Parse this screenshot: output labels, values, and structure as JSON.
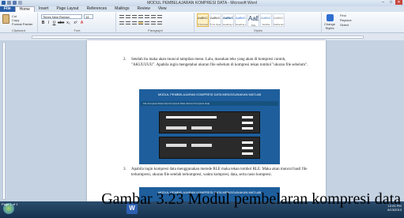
{
  "window": {
    "title": "MODUL PEMBELAJARAN KOMPRESI DATA - Microsoft Word",
    "controls": [
      "–",
      "□",
      "✕"
    ]
  },
  "tabs": [
    "File",
    "Home",
    "Insert",
    "Page Layout",
    "References",
    "Mailings",
    "Review",
    "View"
  ],
  "ribbon": {
    "clipboard": {
      "paste": "Paste",
      "cut": "Cut",
      "copy": "Copy",
      "format_painter": "Format Painter",
      "label": "Clipboard"
    },
    "font": {
      "name": "Times New Roman",
      "size": "14",
      "buttons": [
        "B",
        "I",
        "U",
        "abe",
        "x₂",
        "x²",
        "A"
      ],
      "label": "Font"
    },
    "paragraph_label": "Paragraph",
    "styles": [
      {
        "sample": "AaBbCcDc",
        "name": "¶ Normal"
      },
      {
        "sample": "AaBbCcDc",
        "name": "¶ No Spaci..."
      },
      {
        "sample": "AaBbC",
        "name": "Heading 1"
      },
      {
        "sample": "AaBbCc",
        "name": "Heading 2"
      },
      {
        "sample": "AaB",
        "name": "Title"
      },
      {
        "sample": "AaBbCc.",
        "name": "Subtitle"
      },
      {
        "sample": "AaBbCcDc",
        "name": "Subtle Em..."
      }
    ],
    "styles_label": "Styles",
    "change_styles": "Change Styles",
    "editing": {
      "find": "Find",
      "replace": "Replace",
      "select": "Select",
      "label": "Editing"
    }
  },
  "document": {
    "para2_num": "2.",
    "para2": "Setelah itu maka akan muncul tampilan menu. Lalu, masukan teks yang akan di kompresi contoh, \"AKUUUUU\". Apabila ingin mengetahui ukuran file sebelum di kompresi tekan tombol \"ukuran file sebelum\".",
    "para3_num": "3.",
    "para3": "Apabila ingin kompresi data menggunakan metode RLE maka tekan tombol RLE. Maka akan muncul hasil file terkompresi, ukuran file setelah terkompresi, waktu kompresi, data, serta rasio kompresi.",
    "shot_title": "MODUL PEMBELAJARAN KOMPRESI DATA MENGGUNAKAN MATLAB",
    "shot_menu": "File   Kompresi Data   Opsi   Kompresi Data   Ukuran   Kompresi   Help"
  },
  "caption": "Gambar 3.23 Modul pembelaran kompresi data",
  "taskbar": {
    "word_label": "W",
    "time": "12:01 PM",
    "date": "6/13/2013",
    "status": "Page 1 of 1"
  }
}
